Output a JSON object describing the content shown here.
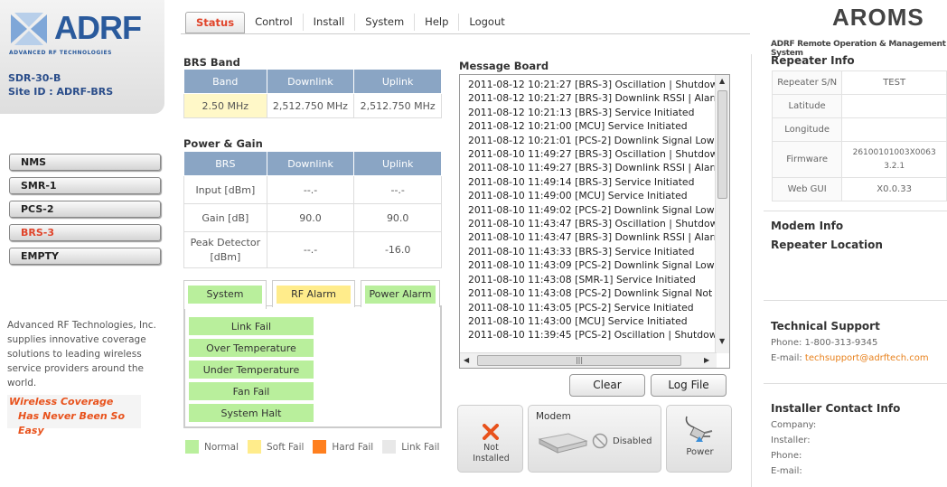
{
  "logo": {
    "brand": "ADRF",
    "tagline": "ADVANCED RF TECHNOLOGIES"
  },
  "device": {
    "model": "SDR-30-B",
    "site_id": "Site ID : ADRF-BRS"
  },
  "device_buttons": [
    "NMS",
    "SMR-1",
    "PCS-2",
    "BRS-3",
    "EMPTY"
  ],
  "active_device": "BRS-3",
  "company_blurb": "Advanced RF Technologies, Inc. supplies innovative coverage solutions to leading wireless service providers around the world.",
  "slogan": {
    "line1": "Wireless Coverage",
    "line2": "Has Never Been So Easy"
  },
  "tabs": [
    "Status",
    "Control",
    "Install",
    "System",
    "Help",
    "Logout"
  ],
  "brs_band": {
    "title": "BRS Band",
    "headers": [
      "Band",
      "Downlink",
      "Uplink"
    ],
    "row": [
      "2.50 MHz",
      "2,512.750 MHz",
      "2,512.750 MHz"
    ]
  },
  "power_gain": {
    "title": "Power & Gain",
    "headers": [
      "BRS",
      "Downlink",
      "Uplink"
    ],
    "rows": [
      {
        "label": "Input [dBm]",
        "downlink": "--.-",
        "uplink": "--.-"
      },
      {
        "label": "Gain [dB]",
        "downlink": "90.0",
        "uplink": "90.0"
      },
      {
        "label": "Peak Detector [dBm]",
        "downlink": "--.-",
        "uplink": "-16.0"
      }
    ]
  },
  "alarm_tabs": [
    "System",
    "RF Alarm",
    "Power Alarm"
  ],
  "alarms": [
    "Link Fail",
    "Over Temperature",
    "Under Temperature",
    "Fan Fail",
    "System Halt"
  ],
  "legend": [
    {
      "label": "Normal",
      "color": "#b9ef9c"
    },
    {
      "label": "Soft Fail",
      "color": "#ffec8b"
    },
    {
      "label": "Hard Fail",
      "color": "#ff7f1e"
    },
    {
      "label": "Link Fail",
      "color": "#e8e8e8"
    }
  ],
  "message_board": {
    "title": "Message Board",
    "messages": [
      "2011-08-12 10:21:27 [BRS-3] Oscillation | Shutdown",
      "2011-08-12 10:21:27 [BRS-3] Downlink RSSI | Alarm",
      "2011-08-12 10:21:13 [BRS-3] Service Initiated",
      "2011-08-12 10:21:00 [MCU] Service Initiated",
      "2011-08-12 10:21:01 [PCS-2] Downlink Signal Low |",
      "2011-08-10 11:49:27 [BRS-3] Oscillation | Shutdown",
      "2011-08-10 11:49:27 [BRS-3] Downlink RSSI | Alarm",
      "2011-08-10 11:49:14 [BRS-3] Service Initiated",
      "2011-08-10 11:49:00 [MCU] Service Initiated",
      "2011-08-10 11:49:02 [PCS-2] Downlink Signal Low |",
      "2011-08-10 11:43:47 [BRS-3] Oscillation | Shutdown",
      "2011-08-10 11:43:47 [BRS-3] Downlink RSSI | Alarm",
      "2011-08-10 11:43:33 [BRS-3] Service Initiated",
      "2011-08-10 11:43:09 [PCS-2] Downlink Signal Low |",
      "2011-08-10 11:43:08 [SMR-1] Service Initiated",
      "2011-08-10 11:43:08 [PCS-2] Downlink Signal Not De",
      "2011-08-10 11:43:05 [PCS-2] Service Initiated",
      "2011-08-10 11:43:00 [MCU] Service Initiated",
      "2011-08-10 11:39:45 [PCS-2] Oscillation | Shutdown"
    ],
    "clear_label": "Clear",
    "log_label": "Log File"
  },
  "status_cards": {
    "not_installed": "Not Installed",
    "modem_title": "Modem",
    "modem_status": "Disabled",
    "power_label": "Power"
  },
  "header": {
    "product": "AROMS",
    "subtitle": "ADRF Remote Operation & Management System"
  },
  "repeater_info": {
    "title": "Repeater Info",
    "rows": [
      {
        "key": "Repeater S/N",
        "value": "TEST"
      },
      {
        "key": "Latitude",
        "value": ""
      },
      {
        "key": "Longitude",
        "value": ""
      },
      {
        "key": "Firmware",
        "value": "26100101003X0063 3.2.1"
      },
      {
        "key": "Web GUI",
        "value": "X0.0.33"
      }
    ]
  },
  "modem_info": {
    "title": "Modem Info"
  },
  "repeater_location": {
    "title": "Repeater Location"
  },
  "tech_support": {
    "title": "Technical Support",
    "phone": "Phone: 1-800-313-9345",
    "email_label": "E-mail: ",
    "email": "techsupport@adrftech.com"
  },
  "installer": {
    "title": "Installer Contact Info",
    "fields": [
      "Company:",
      "Installer:",
      "Phone:",
      "E-mail:"
    ]
  }
}
